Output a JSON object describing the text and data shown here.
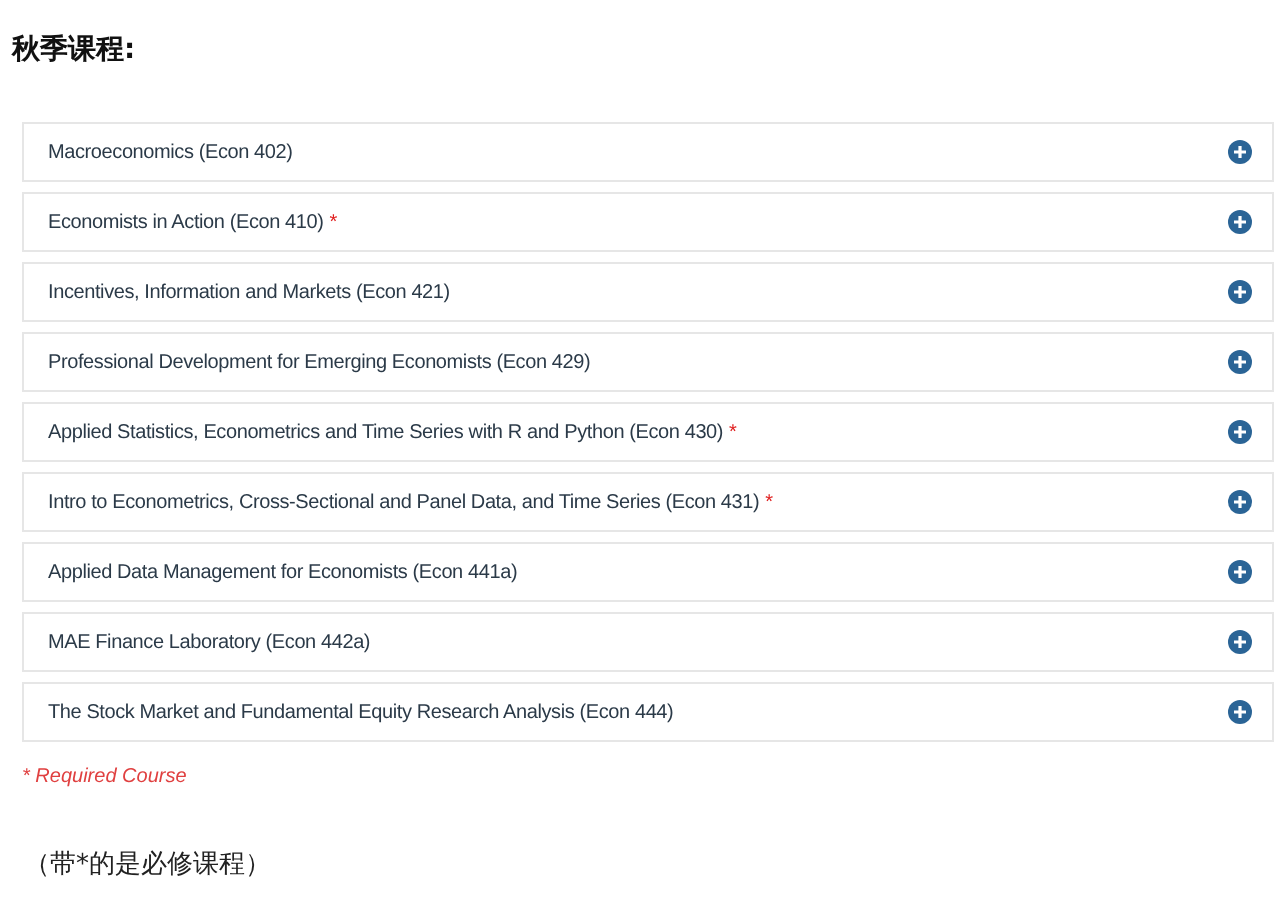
{
  "heading": "秋季课程:",
  "courses": [
    {
      "title": "Macroeconomics (Econ 402)"
    },
    {
      "title": "Economists in Action (Econ 410)",
      "required_mark": "*"
    },
    {
      "title": "Incentives, Information and Markets (Econ 421)"
    },
    {
      "title": "Professional Development for Emerging Economists (Econ 429)"
    },
    {
      "title": "Applied Statistics, Econometrics and Time Series with R and Python (Econ 430)",
      "required_mark": "*"
    },
    {
      "title": "Intro to Econometrics, Cross-Sectional and Panel Data, and Time Series (Econ 431)",
      "required_mark": "*"
    },
    {
      "title": "Applied Data Management for Economists (Econ 441a)"
    },
    {
      "title": "MAE Finance Laboratory (Econ 442a)"
    },
    {
      "title": "The Stock Market and Fundamental Equity Research Analysis (Econ 444)"
    }
  ],
  "legend": "* Required Course",
  "note": "（带*的是必修课程）"
}
